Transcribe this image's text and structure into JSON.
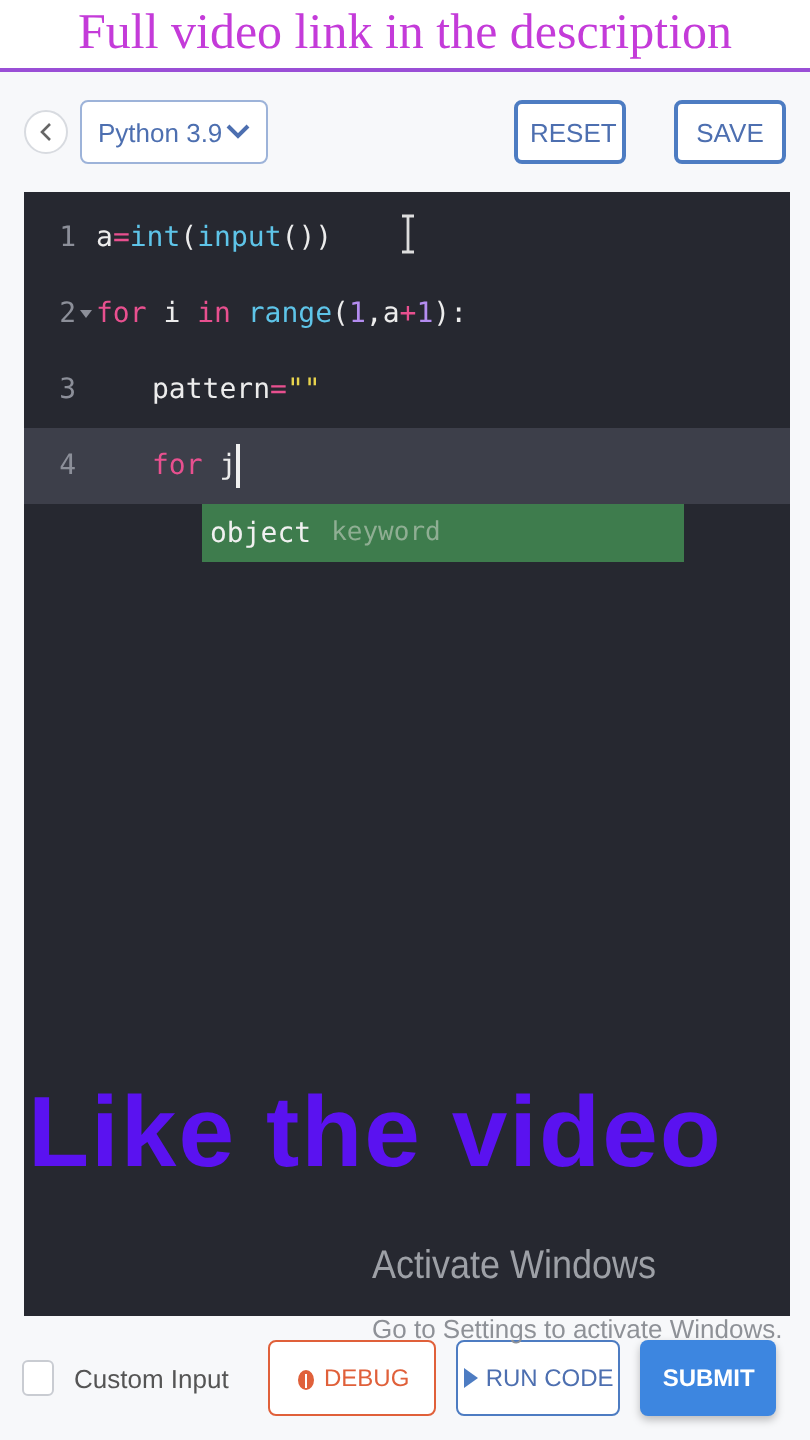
{
  "banner": {
    "text": "Full video link in the description"
  },
  "toolbar": {
    "language": "Python 3.9",
    "buttons": [
      "RESET",
      "SAVE"
    ]
  },
  "editor": {
    "lines": [
      {
        "number": "1",
        "fold": false,
        "active": false,
        "tokens": [
          {
            "kind": "plain",
            "text": "a"
          },
          {
            "kind": "operator",
            "text": "="
          },
          {
            "kind": "function",
            "text": "int"
          },
          {
            "kind": "plain",
            "text": "("
          },
          {
            "kind": "function",
            "text": "input"
          },
          {
            "kind": "plain",
            "text": "())"
          }
        ]
      },
      {
        "number": "2",
        "fold": true,
        "active": false,
        "tokens": [
          {
            "kind": "keyword",
            "text": "for"
          },
          {
            "kind": "plain",
            "text": " i "
          },
          {
            "kind": "keyword",
            "text": "in"
          },
          {
            "kind": "function",
            "text": " range"
          },
          {
            "kind": "plain",
            "text": "("
          },
          {
            "kind": "number",
            "text": "1"
          },
          {
            "kind": "plain",
            "text": ",a"
          },
          {
            "kind": "operator",
            "text": "+"
          },
          {
            "kind": "number",
            "text": "1"
          },
          {
            "kind": "plain",
            "text": "):"
          }
        ],
        "children": [
          {
            "number": "3",
            "fold": false,
            "active": false,
            "tokens": [
              {
                "kind": "plain",
                "text": "pattern"
              },
              {
                "kind": "operator",
                "text": "="
              },
              {
                "kind": "string",
                "text": "\"\""
              }
            ]
          },
          {
            "number": "4",
            "fold": false,
            "active": true,
            "tokens": [
              {
                "kind": "keyword",
                "text": "for"
              },
              {
                "kind": "plain",
                "text": " j"
              }
            ]
          }
        ]
      }
    ],
    "suggestion": {
      "word": "object",
      "type": "keyword"
    }
  },
  "overlay": {
    "text": "Like the video"
  },
  "watermark": {
    "title": "Activate Windows",
    "hint": "Go to Settings to activate Windows."
  },
  "footer": {
    "custom_input": {
      "label": "Custom Input",
      "checked": false
    },
    "buttons": [
      {
        "kind": "debug",
        "label": "DEBUG"
      },
      {
        "kind": "run",
        "label": "RUN CODE"
      },
      {
        "kind": "submit",
        "label": "SUBMIT"
      }
    ]
  }
}
